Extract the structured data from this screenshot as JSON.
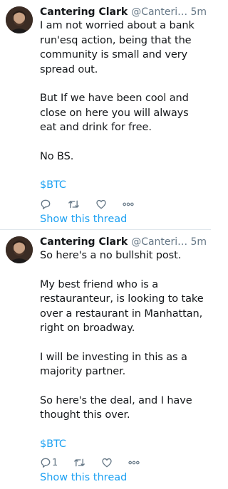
{
  "tweets": [
    {
      "name": "Cantering Clark",
      "handle": "@CanteringClark",
      "time": "5m",
      "paragraphs": [
        "I am not worried about a bank run'esq action, being that the community is small and very spread out.",
        "But If we have been cool and close on here you will always eat and drink for free.",
        "No BS."
      ],
      "cashtag": "$BTC",
      "reply_count": "",
      "show_thread": "Show this thread"
    },
    {
      "name": "Cantering Clark",
      "handle": "@CanteringClark",
      "time": "5m",
      "paragraphs": [
        "So here's a no bullshit post.",
        "My best friend who is a restauranteur, is looking to take over a restaurant in Manhattan, right on broadway.",
        "I will be investing in this as a majority partner.",
        "So here's the deal, and I have thought this over."
      ],
      "cashtag": "$BTC",
      "reply_count": "1",
      "show_thread": "Show this thread"
    }
  ],
  "colors": {
    "link": "#1da1f2",
    "muted": "#657786",
    "text": "#14171a",
    "divider": "#e1e8ed"
  },
  "icons": [
    "avatar-image",
    "reply-icon",
    "retweet-icon",
    "like-icon",
    "more-icon"
  ]
}
